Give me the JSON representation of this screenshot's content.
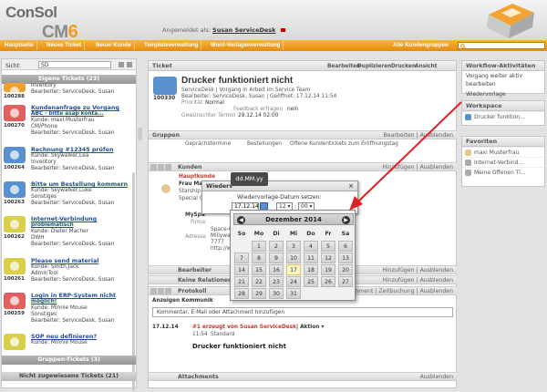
{
  "header": {
    "logo_text": "ConSol",
    "logo_cm": "CM",
    "logo_six": "6",
    "login_prefix": "Angemeldet als:",
    "login_user": "Susan ServiceDesk"
  },
  "nav": {
    "items": [
      "Hauptseite",
      "Neues Ticket",
      "Neuer Kunde",
      "Templateverwaltung",
      "Word-Vorlagenverwaltung",
      "Alle Kundengruppen"
    ]
  },
  "left": {
    "sicht_label": "Sicht:",
    "sicht_value": "SD",
    "own_tickets": "Eigene Tickets (23)",
    "group_tickets": "Gruppen-Tickets (3)",
    "unassigned": "Nicht zugewiesene Tickets (21)",
    "tickets": [
      {
        "id": "100288",
        "title": "",
        "lines": [
          "Inventory",
          "Bearbeiter: ServiceDesk, Susan"
        ],
        "color": "#f0a030"
      },
      {
        "id": "100270",
        "title": "Kundenanfrage zu Vorgang",
        "lines": [
          "ABC - bitte asap konta...",
          "Kunde: maxi Musterfrau",
          "CM/Phone",
          "Bearbeiter: ServiceDesk, Susan"
        ],
        "color": "#e06060"
      },
      {
        "id": "100264",
        "title": "Rechnung #12345 prüfen",
        "lines": [
          "Kunde: Skywalker,Lea",
          "Inventory",
          "Bearbeiter: ServiceDesk, Susan"
        ],
        "color": "#5a8fd0"
      },
      {
        "id": "100263",
        "title": "Bitte um Bestellung kommern",
        "lines": [
          "Kunde: Skywalker,Luke",
          "Sonstiges",
          "Bearbeiter: ServiceDesk, Susan"
        ],
        "color": "#5a8fd0"
      },
      {
        "id": "100262",
        "title": "Internet-Verbindung",
        "lines": [
          "problematisch",
          "Kunde: Dieter Macher",
          "DWH",
          "Bearbeiter: ServiceDesk, Susan"
        ],
        "color": "#d8d04a"
      },
      {
        "id": "100261",
        "title": "Please send material",
        "lines": [
          "Kunde: Smith,Jack",
          "AdminTool",
          "Bearbeiter: ServiceDesk, Susan"
        ],
        "color": "#d8d04a"
      },
      {
        "id": "100259",
        "title": "Login in ERP-System nicht",
        "lines": [
          "möglich!",
          "Kunde: Minnie Mouse",
          "Sonstiges",
          "Bearbeiter: ServiceDesk, Susan"
        ],
        "color": "#e06060"
      },
      {
        "id": "",
        "title": "SOP neu definieren?",
        "lines": [
          "Kunde: Minnie Mouse"
        ],
        "color": "#d8d04a"
      }
    ]
  },
  "main": {
    "panel_title": "Ticket",
    "toolbar": [
      "Bearbeiten",
      "Duplizieren",
      "Drucken",
      "Ansicht"
    ],
    "ticket_id": "100330",
    "title": "Drucker funktioniert nicht",
    "lines": [
      "ServiceDesk | Vorgang in Arbeit im Service Team",
      "Bearbeiter: ServiceDesk, Susan | Geöffnet: 17.12.14 11:54"
    ],
    "prioritaet_label": "Priorität",
    "prioritaet_value": "Normal",
    "feedback_label": "Feedback erfragen",
    "feedback_value": "nein",
    "termin_label": "Gewünschter Termin",
    "termin_value": "29.12.14 02:00",
    "gruppen": "Gruppen",
    "bearbeiten": "Bearbeiten",
    "ausblenden": "Ausblenden",
    "gruppen_values": [
      "Geprächstermine",
      "Bestellungen",
      "Offene Kundentickets zum Eröffnungstag"
    ],
    "kunden": "Kunden",
    "hinzufuegen": "Hinzufügen",
    "hauptkunde": "Hauptkunde",
    "kunde_lines": [
      "Frau Ma",
      "Starship",
      "Special C"
    ],
    "myspace_label": "MySpa",
    "firma_label": "Firma",
    "adresse_label": "Adresse",
    "addr_lines": [
      "Space-C",
      "Millyway",
      "7777",
      "http://ww"
    ],
    "bearbeiter": "Bearbeiter",
    "relationen": "Keine Relationen",
    "protokoll": "Protokoll",
    "protokoll_actions": [
      "mment",
      "Zeitbuchung",
      "Ausblenden"
    ],
    "anzeigen": "Anzeigen Kommunik",
    "comment_placeholder": "Kommentar, E-Mail oder Attachment hinzufügen",
    "entry_date": "17.12.14",
    "entry_head": "#1 erzeugt von Susan ServiceDesk",
    "entry_action": "Aktion",
    "entry_time": "11:54",
    "entry_type": "Standard",
    "entry_title": "Drucker funktioniert nicht",
    "attachments": "Attachments"
  },
  "dialog": {
    "tooltip": "dd.MM.yy",
    "title": "Wiederv",
    "prompt": "Wiedervorlage-Datum setzen:",
    "date_value": "17.12.14",
    "hour": "12",
    "minute": "00",
    "month_label": "Dezember 2014",
    "weekdays": [
      "So",
      "Mo",
      "Di",
      "Mi",
      "Do",
      "Fr",
      "Sa"
    ],
    "days": [
      [
        "",
        "1",
        "2",
        "3",
        "4",
        "5",
        "6"
      ],
      [
        "7",
        "8",
        "9",
        "10",
        "11",
        "12",
        "13"
      ],
      [
        "14",
        "15",
        "16",
        "17",
        "18",
        "19",
        "20"
      ],
      [
        "21",
        "22",
        "23",
        "24",
        "25",
        "26",
        "27"
      ],
      [
        "28",
        "29",
        "30",
        "31",
        "",
        "",
        ""
      ]
    ],
    "today": "17"
  },
  "right": {
    "workflow_title": "Workflow-Aktivitäten",
    "workflow_items": [
      "Vorgang weiter aktiv bearbeiten",
      "Wiedervorlage"
    ],
    "workspace_title": "Workspace",
    "workspace_items": [
      "Drucker funktion..."
    ],
    "favoriten_title": "Favoriten",
    "favoriten_items": [
      "maxi Musterfrau",
      "Internet-Verbind...",
      "Meine Offenen Ti..."
    ]
  }
}
